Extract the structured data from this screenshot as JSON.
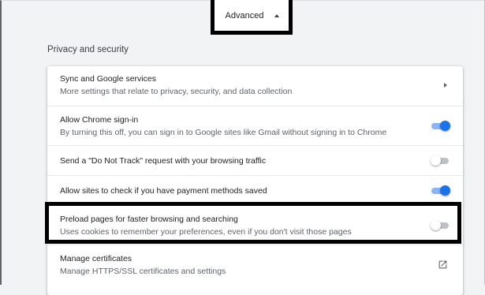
{
  "advanced": {
    "label": "Advanced",
    "icon": "caret-up-icon"
  },
  "section": {
    "title": "Privacy and security"
  },
  "rows": [
    {
      "title": "Sync and Google services",
      "sub": "More settings that relate to privacy, security, and data collection",
      "control": "arrow"
    },
    {
      "title": "Allow Chrome sign-in",
      "sub": "By turning this off, you can sign in to Google sites like Gmail without signing in to Chrome",
      "control": "toggle",
      "on": true
    },
    {
      "title": "Send a \"Do Not Track\" request with your browsing traffic",
      "sub": "",
      "control": "toggle",
      "on": false
    },
    {
      "title": "Allow sites to check if you have payment methods saved",
      "sub": "",
      "control": "toggle",
      "on": true
    },
    {
      "title": "Preload pages for faster browsing and searching",
      "sub": "Uses cookies to remember your preferences, even if you don't visit those pages",
      "control": "toggle",
      "on": false
    },
    {
      "title": "Manage certificates",
      "sub": "Manage HTTPS/SSL certificates and settings",
      "control": "external-link-icon"
    }
  ],
  "colors": {
    "accent": "#1a73e8",
    "highlight_border": "#000000"
  }
}
